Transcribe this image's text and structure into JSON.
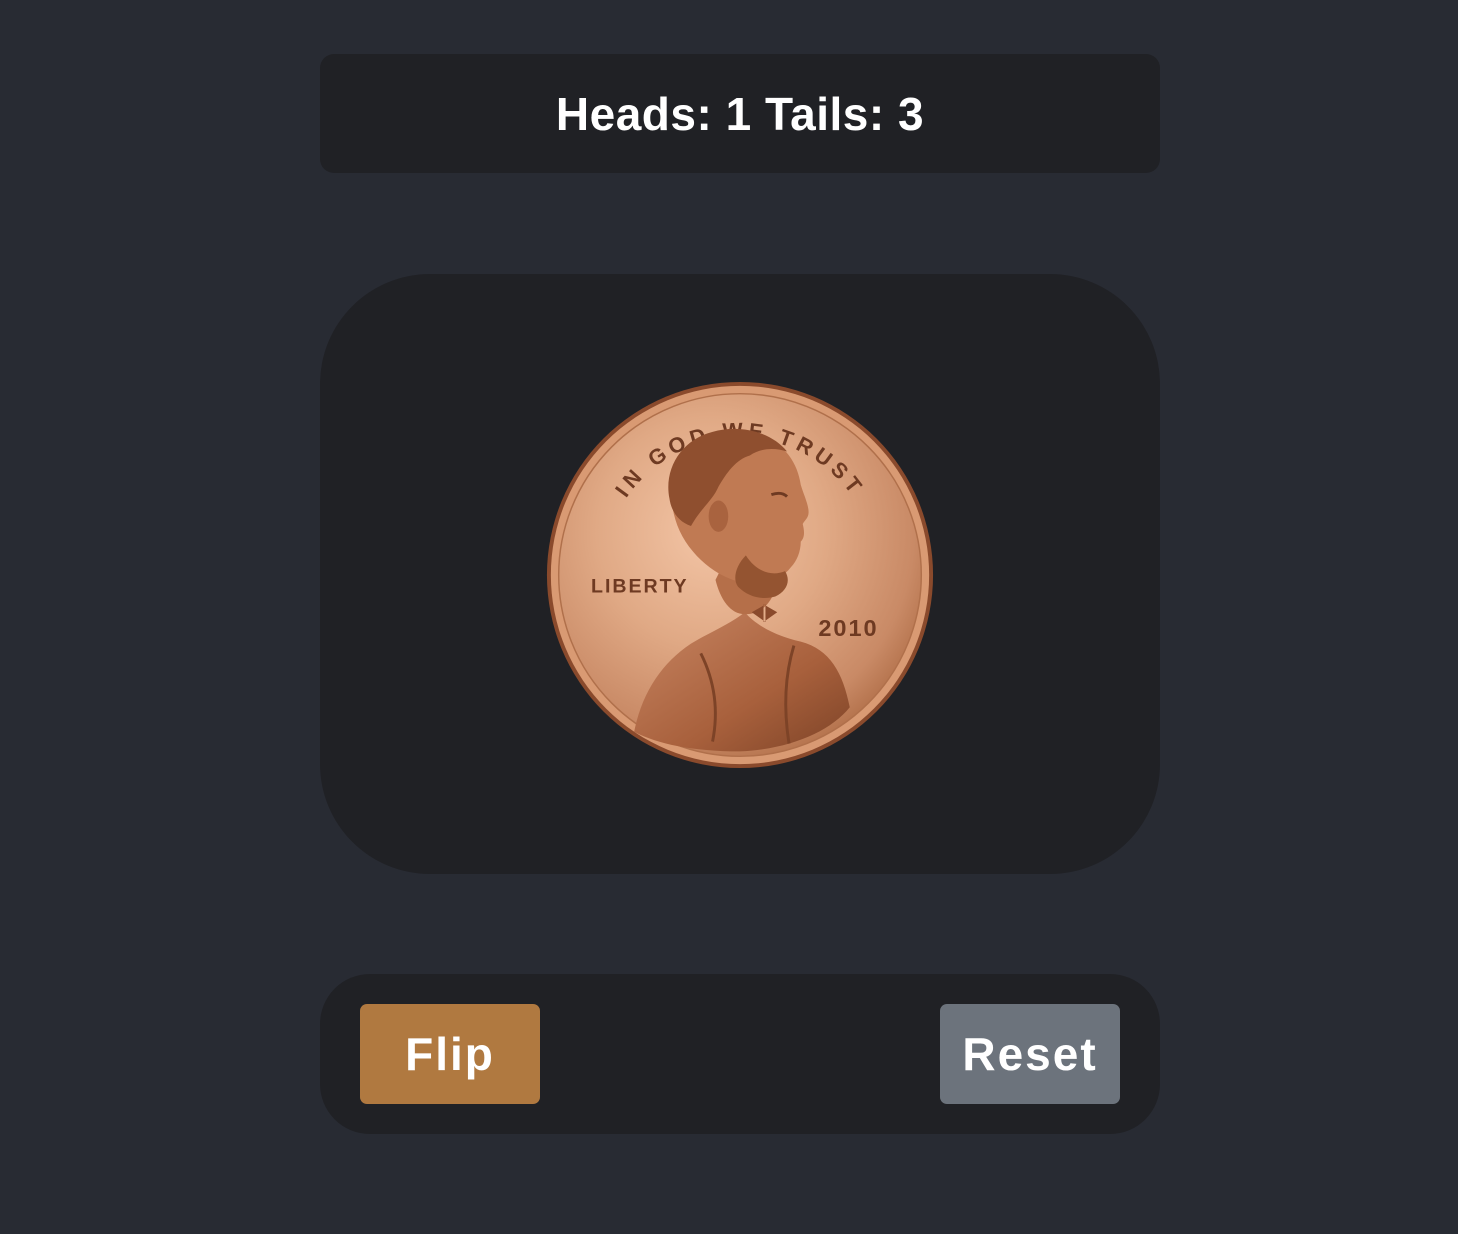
{
  "score": {
    "heads_label": "Heads:",
    "heads_value": "1",
    "tails_label": "Tails:",
    "tails_value": "3"
  },
  "coin": {
    "face": "heads",
    "motto": "IN GOD WE TRUST",
    "liberty": "LIBERTY",
    "year": "2010",
    "icon": "penny-heads-icon"
  },
  "controls": {
    "flip_label": "Flip",
    "reset_label": "Reset"
  },
  "colors": {
    "background": "#282b33",
    "panel": "#202125",
    "flip_button": "#b07940",
    "reset_button": "#6c737c",
    "coin_copper": "#d69a78"
  }
}
